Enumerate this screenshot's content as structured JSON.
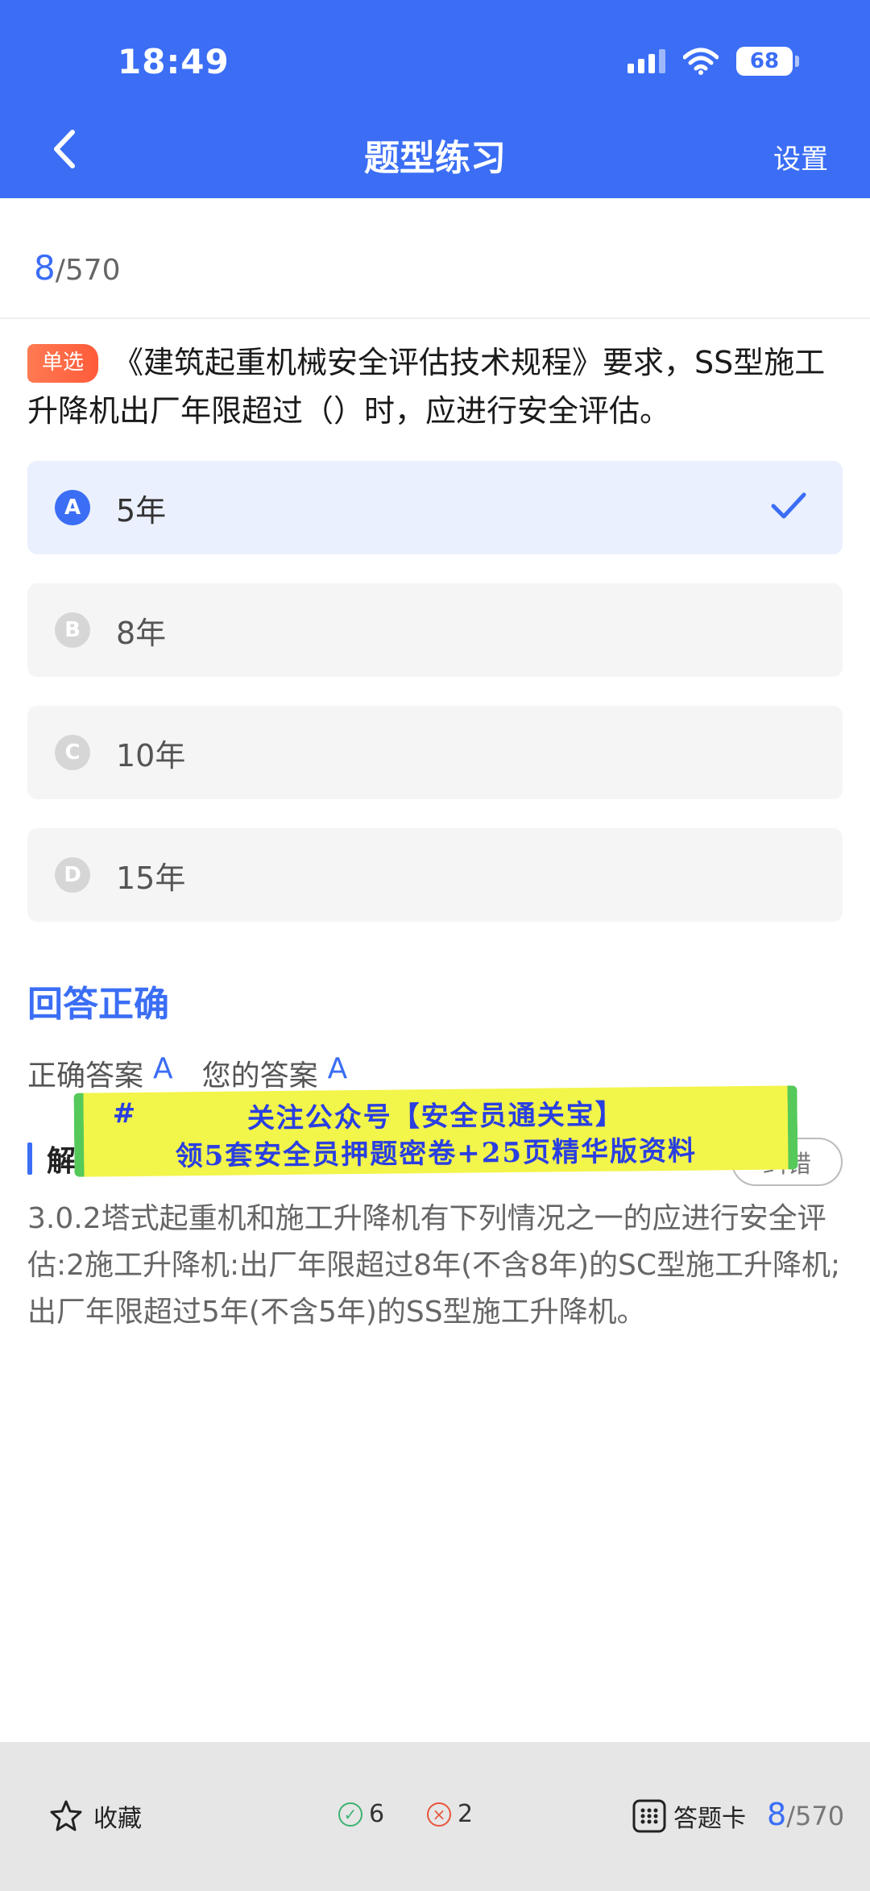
{
  "status_bar": {
    "time": "18:49",
    "battery": "68"
  },
  "header": {
    "title": "题型练习",
    "settings_label": "设置"
  },
  "progress": {
    "current": "8",
    "total": "/570"
  },
  "question": {
    "type_badge": "单选",
    "text": "《建筑起重机械安全评估技术规程》要求，SS型施工升降机出厂年限超过（）时，应进行安全评估。"
  },
  "options": [
    {
      "letter": "A",
      "text": "5年",
      "selected": true
    },
    {
      "letter": "B",
      "text": "8年",
      "selected": false
    },
    {
      "letter": "C",
      "text": "10年",
      "selected": false
    },
    {
      "letter": "D",
      "text": "15年",
      "selected": false
    }
  ],
  "result": {
    "status": "回答正确",
    "correct_label": "正确答案",
    "correct_value": "A",
    "yours_label": "您的答案",
    "yours_value": "A"
  },
  "analysis": {
    "label": "解析",
    "report_button": "纠错",
    "text": "3.0.2塔式起重机和施工升降机有下列情况之一的应进行安全评估:2施工升降机:出厂年限超过8年(不含8年)的SC型施工升降机;出厂年限超过5年(不含5年)的SS型施工升降机。"
  },
  "overlay_banner": {
    "hash": "#",
    "line1": "关注公众号【安全员通关宝】",
    "line2": "领5套安全员押题密卷+25页精华版资料"
  },
  "bottom_bar": {
    "favorite_label": "收藏",
    "correct_count": "6",
    "wrong_count": "2",
    "answer_card_label": "答题卡",
    "progress_current": "8",
    "progress_total": "/570"
  },
  "colors": {
    "primary": "#3b6ef5",
    "badge": "#ff6a45",
    "correct": "#3cb371",
    "wrong": "#e8553c"
  }
}
